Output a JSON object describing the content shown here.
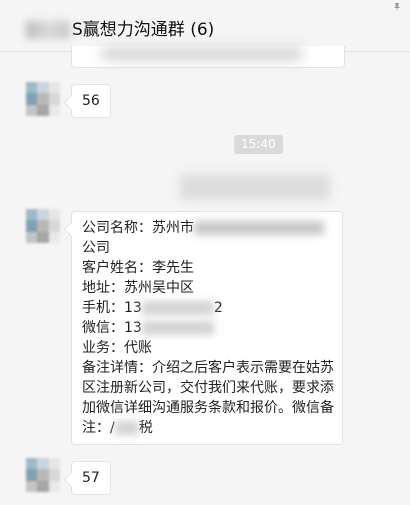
{
  "header": {
    "title": "S赢想力沟通群 (6)",
    "pin_icon": "pin-icon"
  },
  "messages": [
    {
      "type": "text",
      "text": "56"
    },
    {
      "type": "time",
      "text": "15:40"
    },
    {
      "type": "card",
      "lines": {
        "company_label": "公司名称：苏州市",
        "company_tail": "公司",
        "customer": "客户姓名：李先生",
        "address": "地址：苏州吴中区",
        "phone_prefix": "手机：13",
        "phone_suffix": "2",
        "wechat_prefix": "微信：13",
        "business": "业务：代账",
        "remark_head": "备注详情：介绍之后客户表示需要在姑苏区注册新公司，交付我们来代账，要求添加微信详细沟通服务条款和报价。微信备注：",
        "remark_tail": "税",
        "remark_pre": "/"
      }
    },
    {
      "type": "text",
      "text": "57"
    }
  ]
}
